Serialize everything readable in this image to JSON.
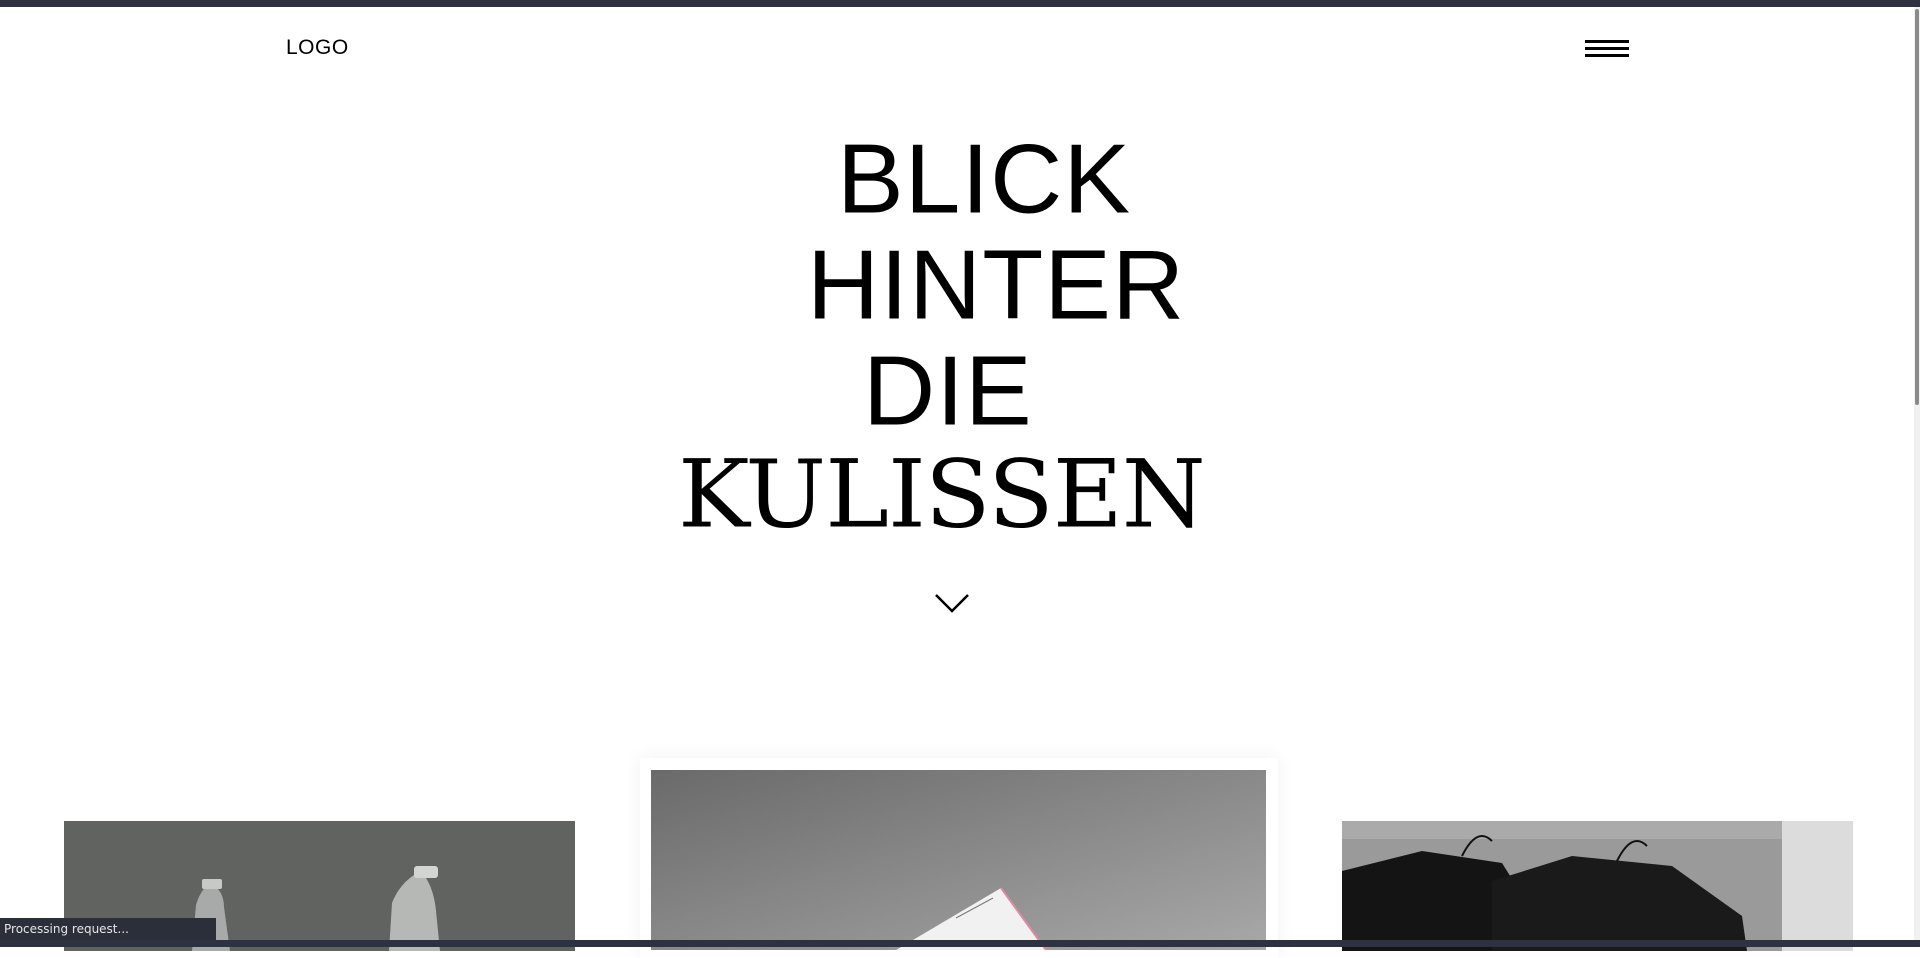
{
  "header": {
    "logo": "LOGO"
  },
  "hero": {
    "lines": [
      "BLICK",
      "HINTER",
      "DIE",
      "KULISSEN"
    ]
  },
  "statusbar": {
    "text": "Processing request..."
  },
  "icons": {
    "menu": "hamburger-icon",
    "scroll": "chevron-down-icon"
  },
  "cards": [
    "beer-bottles-photo",
    "stationery-photo",
    "black-shirts-hanging-photo"
  ]
}
